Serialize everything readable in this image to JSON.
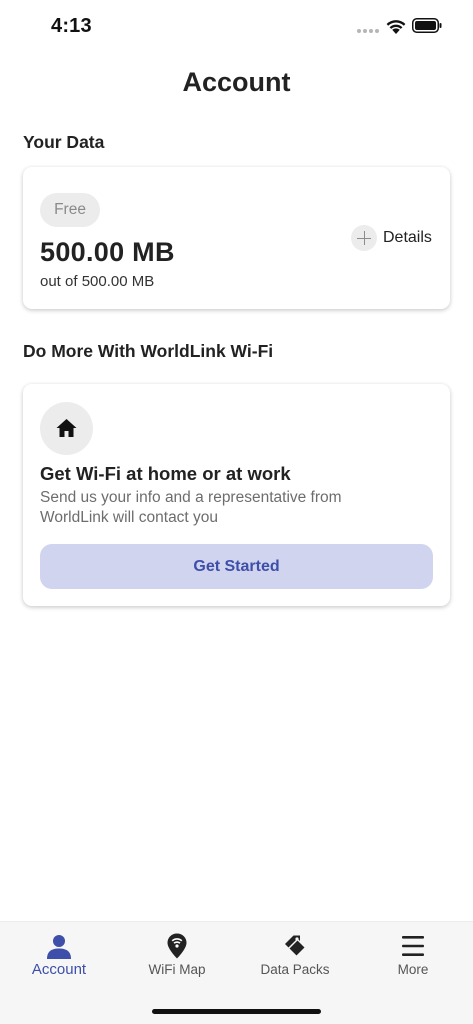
{
  "status_bar": {
    "time": "4:13"
  },
  "header": {
    "title": "Account"
  },
  "your_data": {
    "heading": "Your Data",
    "plan_badge": "Free",
    "remaining": "500.00 MB",
    "total": "out of 500.00 MB",
    "details_label": "Details"
  },
  "do_more": {
    "heading": "Do More With WorldLink Wi-Fi",
    "card_title": "Get Wi-Fi at home or at work",
    "card_description": "Send us your info and a representative from WorldLink will contact you",
    "button_label": "Get Started"
  },
  "tab_bar": {
    "active_tab": "Account",
    "items": [
      {
        "label": "Account",
        "icon": "person-icon"
      },
      {
        "label": "WiFi Map",
        "icon": "map-pin-wifi-icon"
      },
      {
        "label": "Data Packs",
        "icon": "tags-icon"
      },
      {
        "label": "More",
        "icon": "hamburger-menu-icon"
      }
    ]
  },
  "colors": {
    "accent": "#3d4fa8",
    "button_background": "#d0d4ef",
    "badge_background": "#ececec"
  }
}
